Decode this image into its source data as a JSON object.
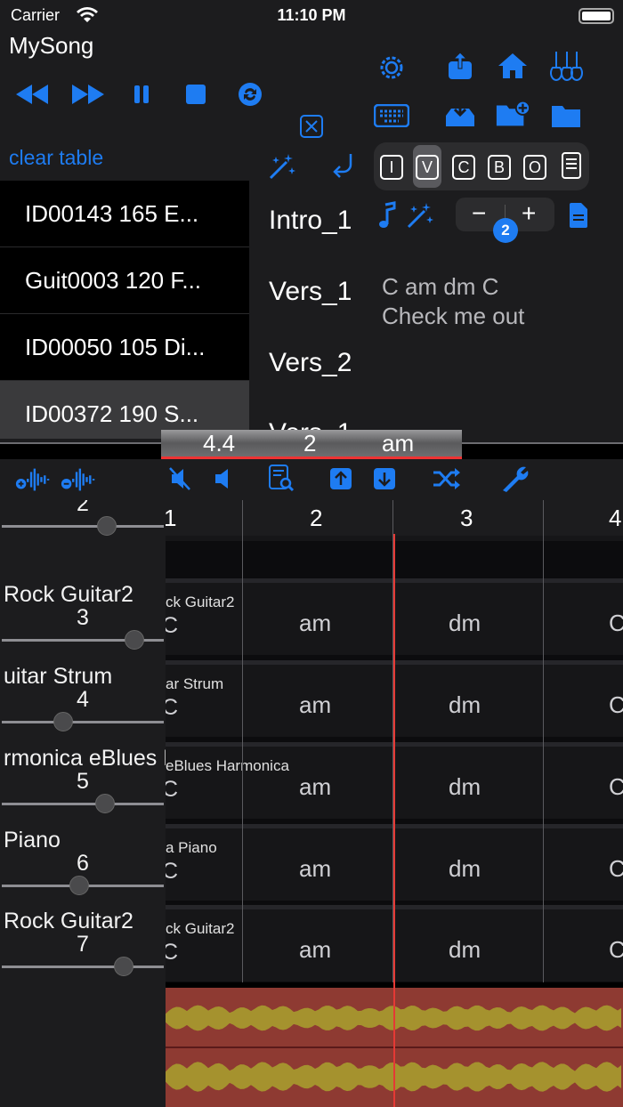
{
  "status": {
    "carrier": "Carrier",
    "time": "11:10 PM"
  },
  "song": {
    "title": "MySong"
  },
  "controls": {
    "transport": [
      "rewind-icon",
      "fast-forward-icon",
      "pause-icon",
      "stop-icon",
      "loop-icon"
    ],
    "clear_table": "clear table"
  },
  "song_list": [
    {
      "label": "ID00143 165 E...",
      "selected": false
    },
    {
      "label": "Guit0003 120 F...",
      "selected": false
    },
    {
      "label": "ID00050 105 Di...",
      "selected": false
    },
    {
      "label": "ID00372 190 S...",
      "selected": true
    }
  ],
  "sections": [
    "Intro_1",
    "Vers_1",
    "Vers_2",
    "Vers_1"
  ],
  "parts": [
    "I",
    "V",
    "C",
    "B",
    "O"
  ],
  "selected_part": "V",
  "stepper": {
    "minus": "−",
    "plus": "+",
    "value": "2"
  },
  "chords_text": {
    "line1": "C am dm C",
    "line2": "Check me out"
  },
  "position": {
    "time_sig": "4.4",
    "bar": "2",
    "chord": "am"
  },
  "ruler": [
    "1",
    "2",
    "3",
    "4"
  ],
  "tracks": [
    {
      "name": "",
      "number": "2",
      "grid_name": "",
      "volume": 0.65,
      "cells": [
        "am",
        "dm",
        "C"
      ]
    },
    {
      "name": "Rock Guitar2",
      "number": "3",
      "grid_name": "ck Guitar2",
      "volume": 0.82,
      "cells": [
        "am",
        "dm",
        "C"
      ]
    },
    {
      "name": "uitar Strum",
      "number": "4",
      "grid_name": "ar Strum",
      "volume": 0.38,
      "cells": [
        "am",
        "dm",
        "C"
      ]
    },
    {
      "name": "rmonica eBlues Ha",
      "number": "5",
      "grid_name": "eBlues Harmonica",
      "volume": 0.64,
      "cells": [
        "am",
        "dm",
        "C"
      ]
    },
    {
      "name": "Piano",
      "number": "6",
      "grid_name": "a Piano",
      "volume": 0.48,
      "cells": [
        "am",
        "dm",
        "C"
      ]
    },
    {
      "name": "Rock Guitar2",
      "number": "7",
      "grid_name": "ck Guitar2",
      "volume": 0.75,
      "cells": [
        "am",
        "dm",
        "C"
      ]
    }
  ],
  "master_volume": 0.33,
  "colors": {
    "accent": "#1e7cf2",
    "playhead": "#e53935",
    "wave_bg": "#8e3a32",
    "wave": "#a5922e"
  }
}
